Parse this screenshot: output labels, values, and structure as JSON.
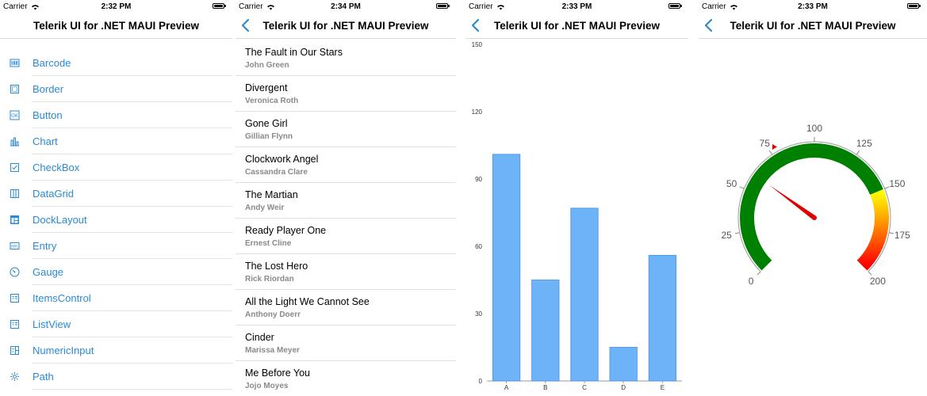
{
  "screens": [
    {
      "status": {
        "carrier": "Carrier",
        "time": "2:32 PM"
      },
      "nav": {
        "title": "Telerik UI for .NET MAUI Preview"
      },
      "menu": [
        {
          "label": "Barcode",
          "icon": "barcode-icon"
        },
        {
          "label": "Border",
          "icon": "border-icon"
        },
        {
          "label": "Button",
          "icon": "button-icon"
        },
        {
          "label": "Chart",
          "icon": "chart-icon"
        },
        {
          "label": "CheckBox",
          "icon": "checkbox-icon"
        },
        {
          "label": "DataGrid",
          "icon": "datagrid-icon"
        },
        {
          "label": "DockLayout",
          "icon": "docklayout-icon"
        },
        {
          "label": "Entry",
          "icon": "entry-icon"
        },
        {
          "label": "Gauge",
          "icon": "gauge-icon"
        },
        {
          "label": "ItemsControl",
          "icon": "itemscontrol-icon"
        },
        {
          "label": "ListView",
          "icon": "listview-icon"
        },
        {
          "label": "NumericInput",
          "icon": "numericinput-icon"
        },
        {
          "label": "Path",
          "icon": "path-icon"
        }
      ]
    },
    {
      "status": {
        "carrier": "Carrier",
        "time": "2:34 PM"
      },
      "nav": {
        "title": "Telerik UI for .NET MAUI Preview"
      },
      "books": [
        {
          "title": "The Fault in Our Stars",
          "author": "John Green"
        },
        {
          "title": "Divergent",
          "author": "Veronica Roth"
        },
        {
          "title": "Gone Girl",
          "author": "Gillian Flynn"
        },
        {
          "title": "Clockwork Angel",
          "author": "Cassandra Clare"
        },
        {
          "title": "The Martian",
          "author": "Andy Weir"
        },
        {
          "title": "Ready Player One",
          "author": "Ernest Cline"
        },
        {
          "title": "The Lost Hero",
          "author": "Rick Riordan"
        },
        {
          "title": "All the Light We Cannot See",
          "author": "Anthony Doerr"
        },
        {
          "title": "Cinder",
          "author": "Marissa Meyer"
        },
        {
          "title": "Me Before You",
          "author": "Jojo Moyes"
        }
      ]
    },
    {
      "status": {
        "carrier": "Carrier",
        "time": "2:33 PM"
      },
      "nav": {
        "title": "Telerik UI for .NET MAUI Preview"
      }
    },
    {
      "status": {
        "carrier": "Carrier",
        "time": "2:33 PM"
      },
      "nav": {
        "title": "Telerik UI for .NET MAUI Preview"
      },
      "gauge": {
        "min": 0,
        "max": 200,
        "labels": [
          "0",
          "25",
          "50",
          "75",
          "100",
          "125",
          "150",
          "175",
          "200"
        ],
        "needle_value": 60,
        "marker_value": 78,
        "ranges": [
          {
            "from": 0,
            "to": 150,
            "color": "#008000"
          },
          {
            "from": 150,
            "to": 200,
            "gradient": [
              "#ffff00",
              "#ff0000"
            ]
          }
        ],
        "needle_color": "#e00000",
        "marker_color": "#e00000"
      }
    }
  ],
  "colors": {
    "accent": "#2a8ad4",
    "bar_fill": "#6db3f8",
    "bar_stroke": "#4a90e2"
  },
  "chart_data": {
    "type": "bar",
    "categories": [
      "A",
      "B",
      "C",
      "D",
      "E"
    ],
    "values": [
      101,
      45,
      77,
      15,
      56
    ],
    "ylim": [
      0,
      150
    ],
    "yticks": [
      0,
      30,
      60,
      90,
      120,
      150
    ],
    "title": "",
    "xlabel": "",
    "ylabel": ""
  }
}
